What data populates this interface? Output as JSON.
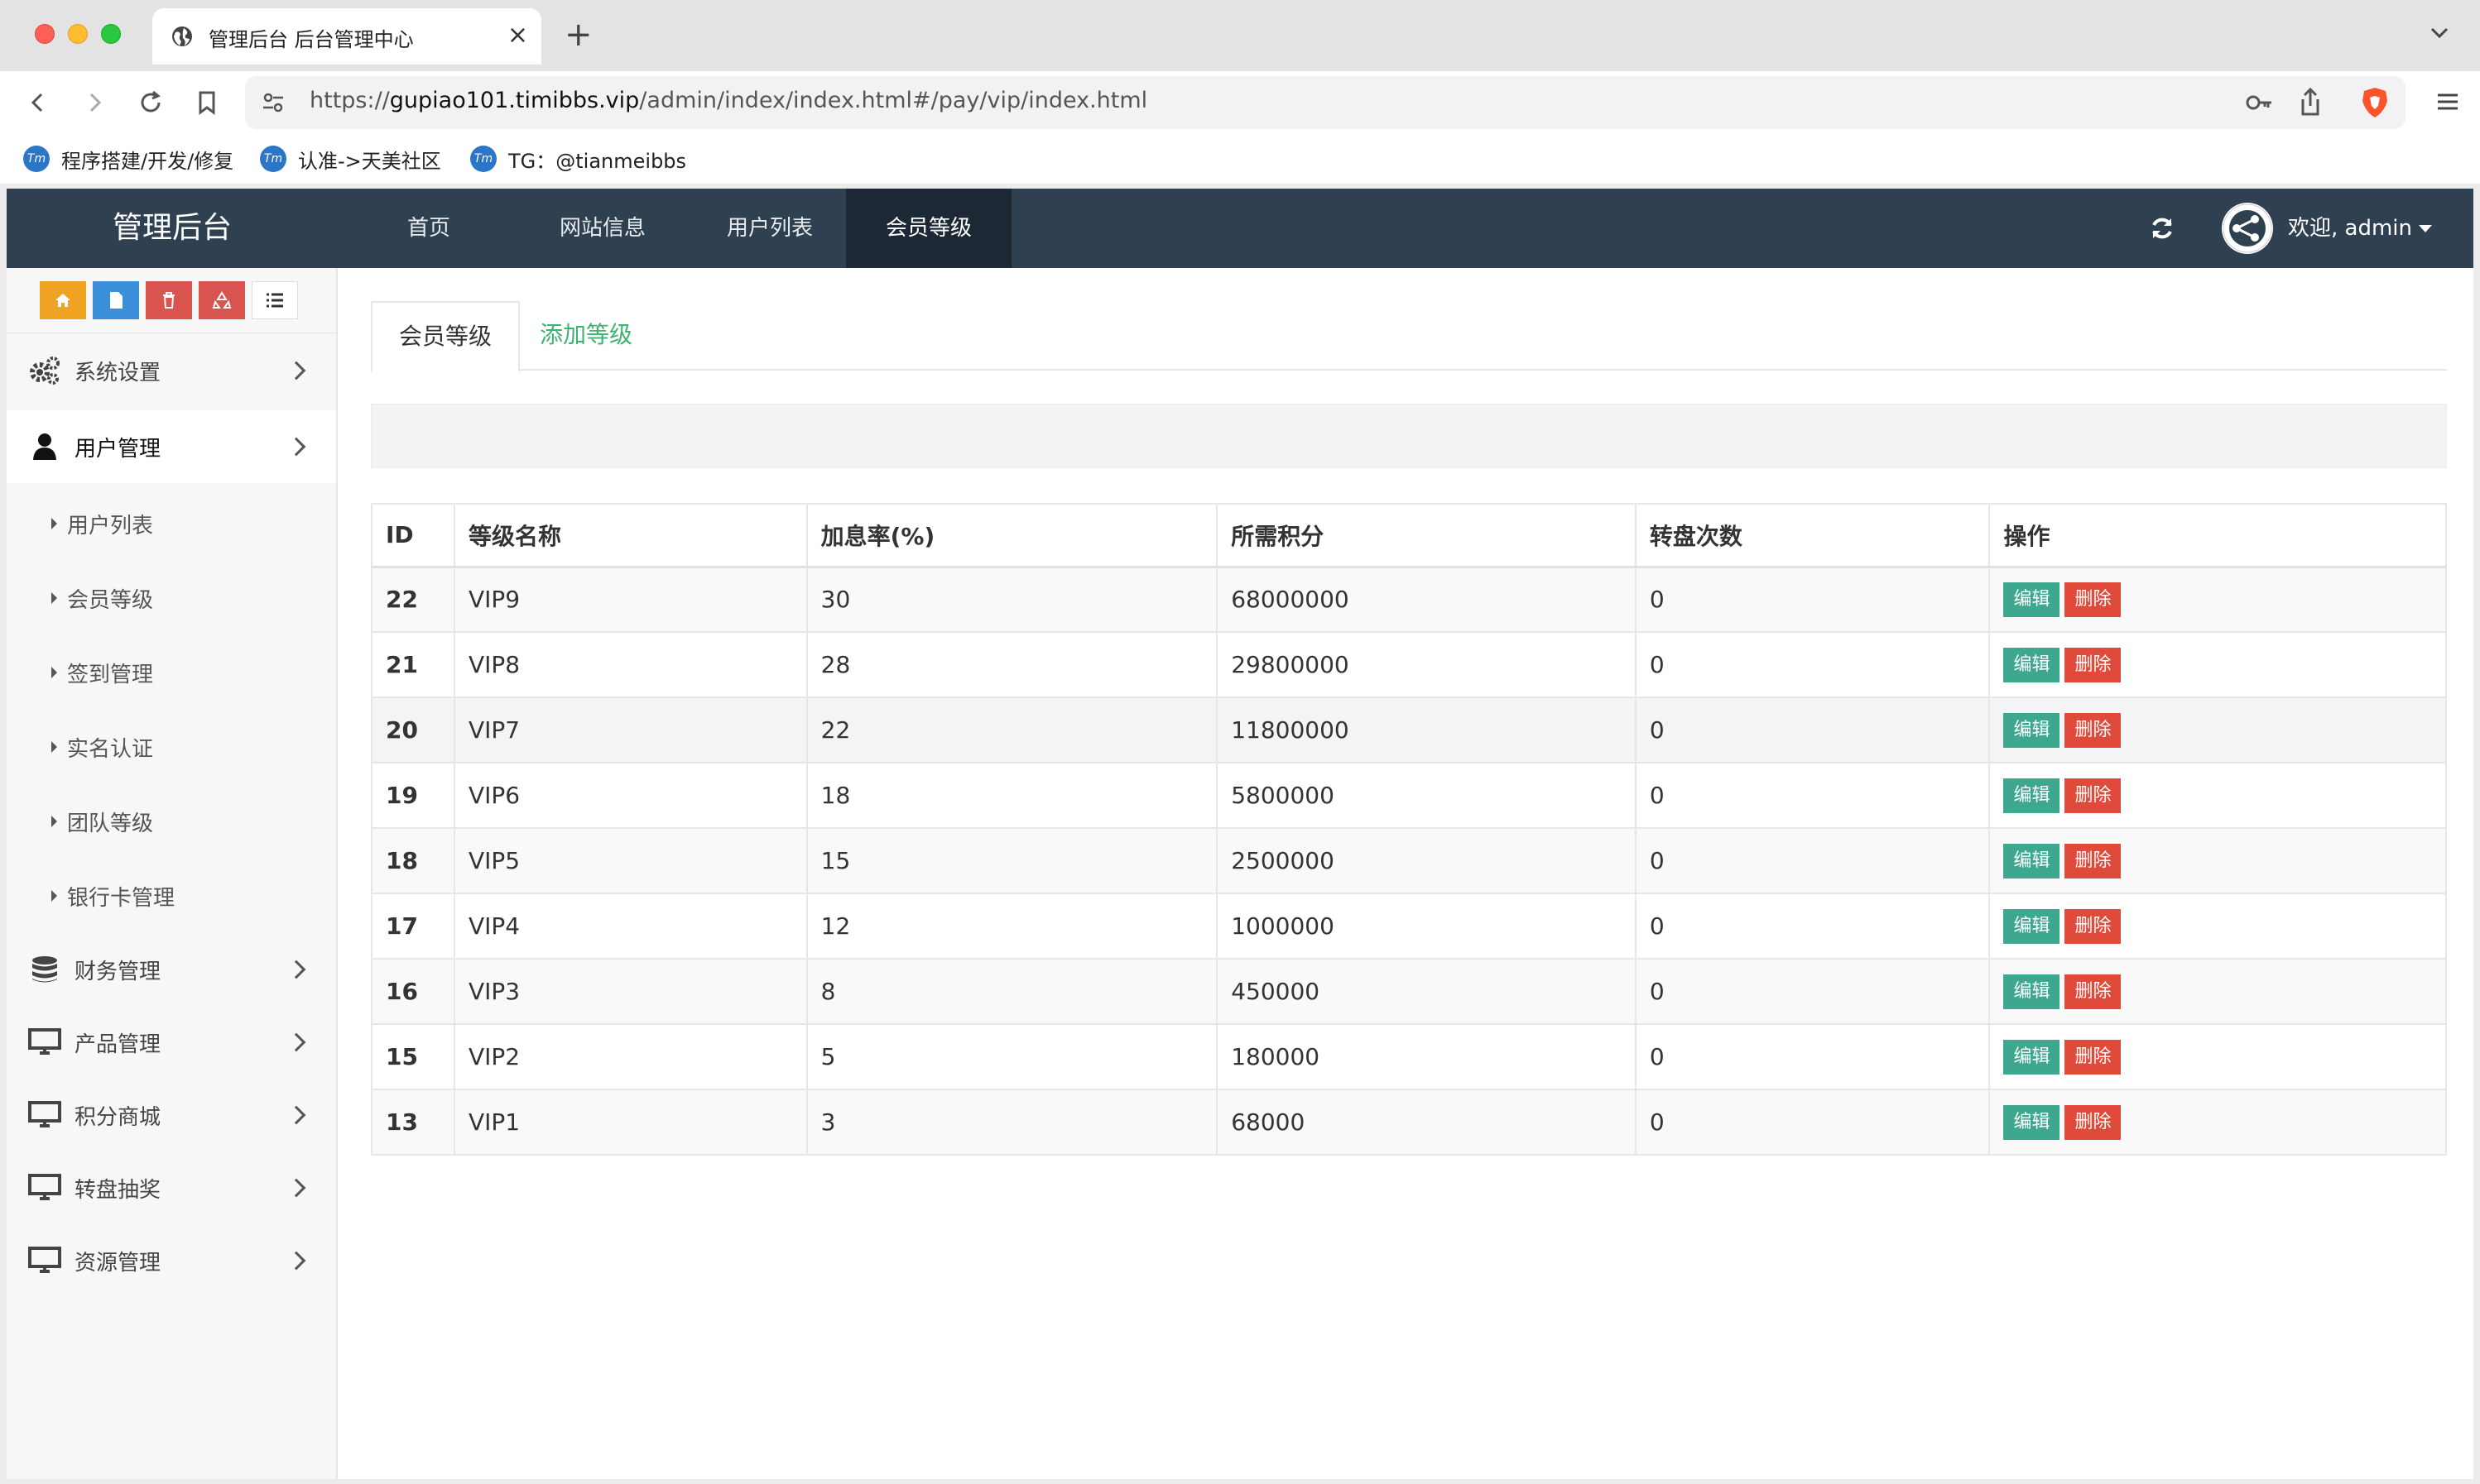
{
  "browser": {
    "tab_title": "管理后台 后台管理中心",
    "url_prefix": "https://",
    "url_host": "gupiao101.timibbs.vip",
    "url_path": "/admin/index/index.html#/pay/vip/index.html",
    "bookmarks": [
      {
        "label": "程序搭建/开发/修复",
        "icon": "tm-logo-icon"
      },
      {
        "label": "认准->天美社区",
        "icon": "tm-logo-icon"
      },
      {
        "label": "TG：@tianmeibbs",
        "icon": "tm-logo-icon"
      }
    ]
  },
  "header": {
    "brand": "管理后台",
    "menu": [
      "首页",
      "网站信息",
      "用户列表",
      "会员等级"
    ],
    "active_menu": "会员等级",
    "welcome": "欢迎, admin"
  },
  "sidebar": {
    "quick_buttons": [
      "home-icon",
      "file-icon",
      "trash-icon",
      "recycle-icon",
      "list-icon"
    ],
    "items": [
      {
        "label": "系统设置",
        "icon": "gears-icon"
      },
      {
        "label": "用户管理",
        "icon": "user-icon"
      },
      {
        "label": "财务管理",
        "icon": "database-icon"
      },
      {
        "label": "产品管理",
        "icon": "desktop-icon"
      },
      {
        "label": "积分商城",
        "icon": "desktop-icon"
      },
      {
        "label": "转盘抽奖",
        "icon": "desktop-icon"
      },
      {
        "label": "资源管理",
        "icon": "desktop-icon"
      }
    ],
    "subitems": [
      "用户列表",
      "会员等级",
      "签到管理",
      "实名认证",
      "团队等级",
      "银行卡管理"
    ]
  },
  "main": {
    "tabs": [
      "会员等级",
      "添加等级"
    ],
    "columns": [
      "ID",
      "等级名称",
      "加息率(%)",
      "所需积分",
      "转盘次数",
      "操作"
    ],
    "rows": [
      [
        "22",
        "VIP9",
        "30",
        "68000000",
        "0"
      ],
      [
        "21",
        "VIP8",
        "28",
        "29800000",
        "0"
      ],
      [
        "20",
        "VIP7",
        "22",
        "11800000",
        "0"
      ],
      [
        "19",
        "VIP6",
        "18",
        "5800000",
        "0"
      ],
      [
        "18",
        "VIP5",
        "15",
        "2500000",
        "0"
      ],
      [
        "17",
        "VIP4",
        "12",
        "1000000",
        "0"
      ],
      [
        "16",
        "VIP3",
        "8",
        "450000",
        "0"
      ],
      [
        "15",
        "VIP2",
        "5",
        "180000",
        "0"
      ],
      [
        "13",
        "VIP1",
        "3",
        "68000",
        "0"
      ]
    ],
    "edit_label": "编辑",
    "delete_label": "删除"
  },
  "colors": {
    "topnav": "#2f4050",
    "active_menu": "#1c2833",
    "edit": "#3ea88e",
    "delete": "#df4a3a",
    "link": "#3cb371"
  }
}
